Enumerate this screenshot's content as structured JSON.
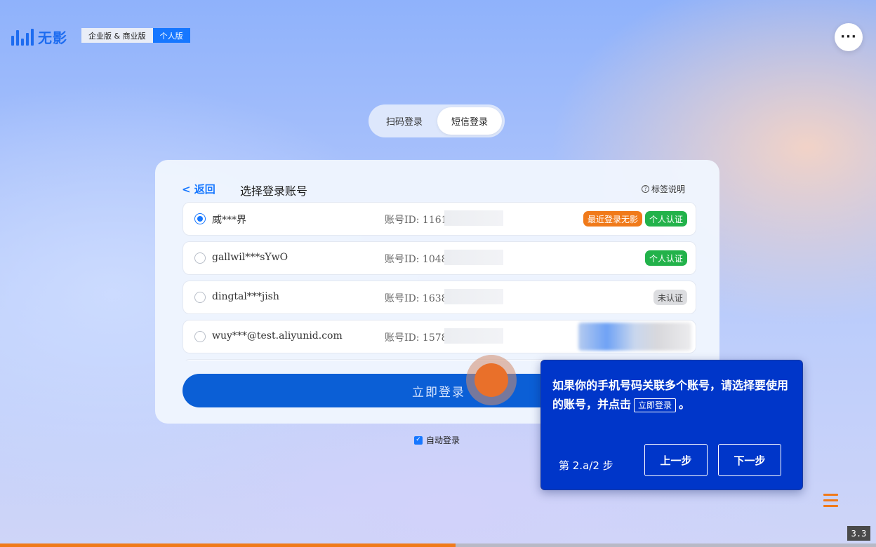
{
  "header": {
    "logo_text": "无影",
    "edition_enterprise": "企业版 & 商业版",
    "edition_personal": "个人版",
    "more_label": "···"
  },
  "login_tabs": {
    "qr": "扫码登录",
    "sms": "短信登录",
    "active": "sms"
  },
  "card": {
    "back": "< 返回",
    "title": "选择登录账号",
    "label_help": "标签说明",
    "help_icon_glyph": "?",
    "accounts": [
      {
        "name": "威***界",
        "id_label": "账号ID: 11612",
        "selected": true,
        "badges": [
          "最近登录无影",
          "个人认证"
        ]
      },
      {
        "name": "gallwil***sYwO",
        "id_label": "账号ID: 10481",
        "selected": false,
        "badges": [
          "个人认证"
        ]
      },
      {
        "name": "dingtal***jish",
        "id_label": "账号ID: 16382",
        "selected": false,
        "badges": [
          "未认证"
        ]
      },
      {
        "name": "wuy***@test.aliyunid.com",
        "id_label": "账号ID: 15786",
        "selected": false,
        "badges": []
      }
    ],
    "login_button": "立即登录"
  },
  "auto_login": {
    "label": "自动登录",
    "checked": true,
    "check_glyph": "✓"
  },
  "tutorial": {
    "text_before": "如果你的手机号码关联多个账号，请选择要使用的账号，并点击",
    "inline_button": "立即登录",
    "text_after": "。",
    "step": "第 2.a/2 步",
    "prev": "上一步",
    "next": "下一步"
  },
  "player": {
    "progress": 0.52,
    "version": "3.3"
  },
  "colors": {
    "primary": "#1677ff",
    "login_button": "#0b5fd6",
    "tutorial_bg": "#0036c9",
    "accent_orange": "#f07a1a",
    "badge_green": "#22b24a"
  },
  "icons": [
    "logo-icon",
    "more-icon",
    "help-icon",
    "radio-icon",
    "checkbox-icon",
    "menu-icon",
    "click-indicator-icon"
  ]
}
